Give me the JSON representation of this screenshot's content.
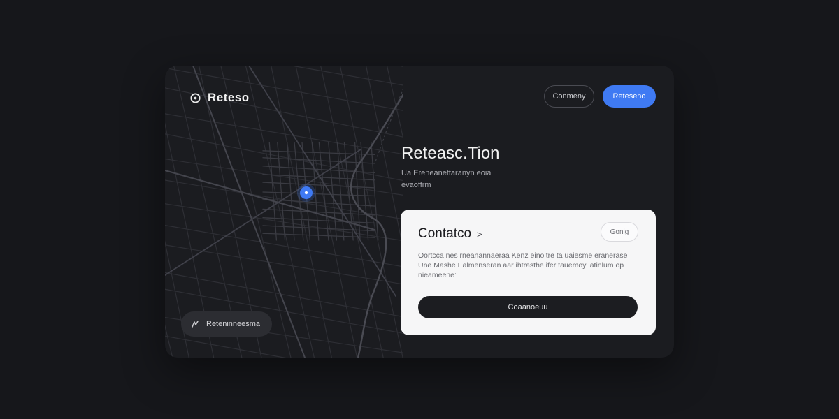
{
  "brand": {
    "logo_text": "Reteso",
    "logo_icon": "location-pin-icon"
  },
  "header": {
    "secondary_button_label": "Conmeny",
    "primary_button_label": "Reteseno"
  },
  "hero": {
    "title": "Reteasc.Tion",
    "subtitle": "Ua Ereneanettaranyn eoia evaoffrm"
  },
  "map": {
    "pin_icon": "map-pin-icon",
    "pill_icon": "route-icon",
    "pill_label": "Reteninneesma"
  },
  "card": {
    "title": "Contatco",
    "chevron_icon": "chevron-right-icon",
    "badge_label": "Gonig",
    "body": "Oortcca nes rneanannaeraa Kenz einoitre ta uaiesme eranerase Une Mashe Ealmenseran aar ihtrasthe ifer tauemoy latinlum op nieameene:",
    "button_label": "Coaanoeuu"
  },
  "colors": {
    "accent": "#3f7af3",
    "background": "#16171b",
    "panel": "#1b1c20",
    "card": "#f6f6f7",
    "card_button": "#1c1d21"
  }
}
